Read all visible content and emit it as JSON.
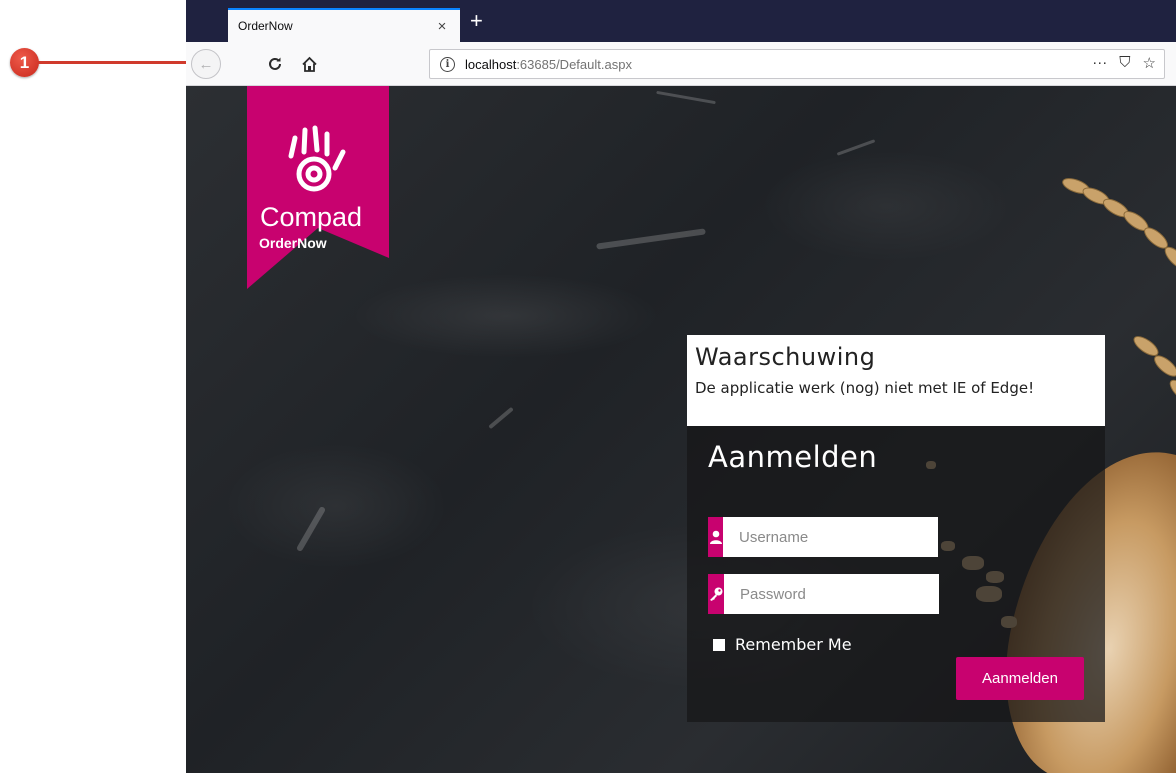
{
  "annotation": {
    "number": "1"
  },
  "browser": {
    "tab_title": "OrderNow",
    "tab_close": "×",
    "new_tab": "+",
    "url_host": "localhost",
    "url_rest": ":63685/Default.aspx",
    "url_info": "i",
    "page_actions": "···",
    "pocket": "⛉",
    "bookmark": "☆",
    "back": "←",
    "reload": "C",
    "home": "⌂"
  },
  "logo": {
    "brand": "Compad",
    "product": "OrderNow"
  },
  "warning": {
    "title": "Waarschuwing",
    "message": "De applicatie werk (nog) niet met IE of Edge!"
  },
  "login": {
    "title": "Aanmelden",
    "username_placeholder": "Username",
    "password_placeholder": "Password",
    "remember_label": "Remember Me",
    "submit_label": "Aanmelden"
  },
  "colors": {
    "accent": "#c8026f",
    "tabbar": "#1f2240",
    "annotation": "#d03a2c"
  },
  "icons": {
    "username": "user-icon",
    "password": "key-icon"
  }
}
